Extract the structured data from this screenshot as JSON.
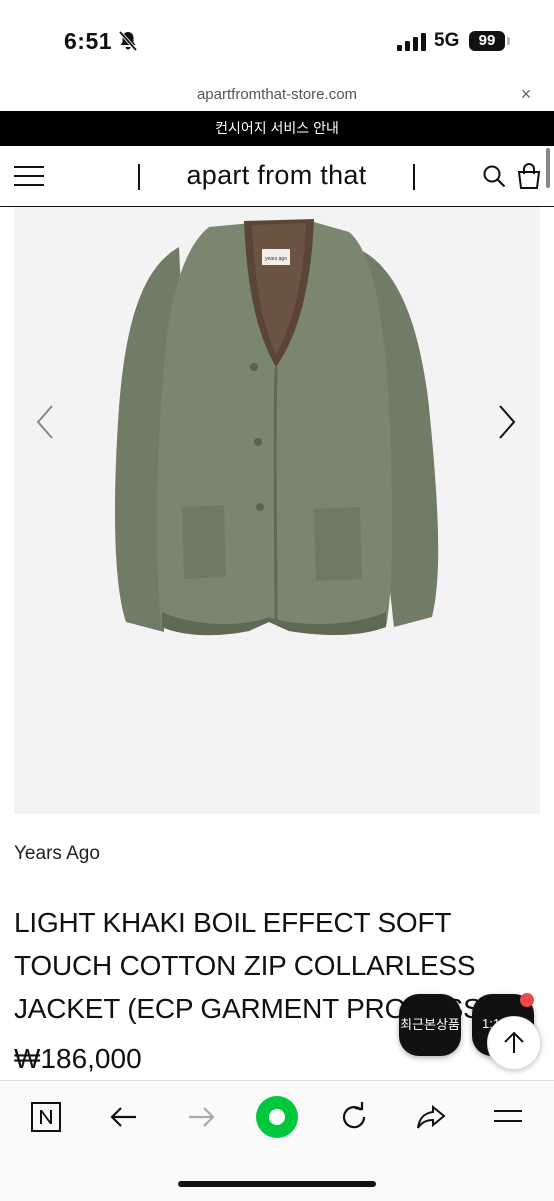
{
  "status_bar": {
    "time": "6:51",
    "network": "5G",
    "battery": "99",
    "icons": [
      "bell-slash-icon",
      "signal-icon",
      "battery-icon"
    ]
  },
  "browser": {
    "url": "apartfromthat-store.com",
    "close_symbol": "×"
  },
  "banner": {
    "text": "컨시어지 서비스 안내"
  },
  "header": {
    "logo": "apart from that",
    "icons": [
      "menu-icon",
      "search-icon",
      "shopping-bag-icon"
    ]
  },
  "product": {
    "brand": "Years Ago",
    "title": "LIGHT KHAKI BOIL EFFECT SOFT TOUCH COTTON ZIP COLLARLESS JACKET (ECP GARMENT PROCESS)",
    "price": "₩186,000",
    "image_label": "years ago",
    "image_colors": {
      "jacket": "#7b8670",
      "jacket_shadow": "#5f6a55",
      "lining": "#5a4536",
      "background": "#f3f3f3"
    }
  },
  "floating": {
    "recent_label": "최근본상품",
    "chat_label": "1:1",
    "badge_color": "#f04848"
  },
  "toolbar": {
    "icons": [
      "naver-n-icon",
      "back-arrow-icon",
      "forward-arrow-icon",
      "green-dot-icon",
      "refresh-icon",
      "share-icon",
      "menu-lines-icon"
    ],
    "accent_color": "#00c73c"
  }
}
